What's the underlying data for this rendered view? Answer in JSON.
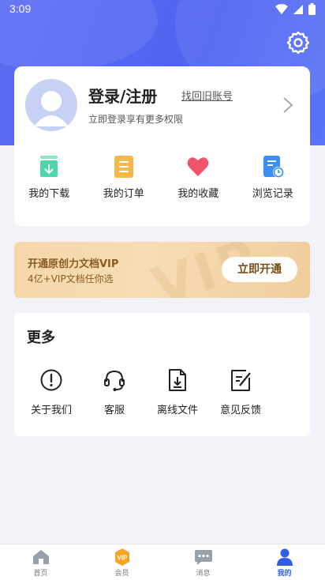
{
  "status_bar": {
    "time": "3:09"
  },
  "profile": {
    "login_title": "登录/注册",
    "recover_link": "找回旧账号",
    "login_sub": "立即登录享有更多权限"
  },
  "quick_actions": [
    {
      "label": "我的下载",
      "icon": "download-tray-icon",
      "color": "#4dd6a8"
    },
    {
      "label": "我的订单",
      "icon": "order-list-icon",
      "color": "#f7b84a"
    },
    {
      "label": "我的收藏",
      "icon": "heart-icon",
      "color": "#f0546a"
    },
    {
      "label": "浏览记录",
      "icon": "history-document-icon",
      "color": "#3a8ff5"
    }
  ],
  "vip": {
    "title": "开通原创力文档VIP",
    "subtitle": "4亿+VIP文档任你选",
    "button": "立即开通",
    "watermark": "VIP"
  },
  "more": {
    "title": "更多",
    "items": [
      {
        "label": "关于我们",
        "icon": "info-exclamation-icon"
      },
      {
        "label": "客服",
        "icon": "headset-icon"
      },
      {
        "label": "离线文件",
        "icon": "file-download-icon"
      },
      {
        "label": "意见反馈",
        "icon": "feedback-edit-icon"
      }
    ]
  },
  "tabs": [
    {
      "label": "首页",
      "icon": "home-icon"
    },
    {
      "label": "会员",
      "icon": "vip-badge-icon",
      "badge": "VIP"
    },
    {
      "label": "消息",
      "icon": "message-bubble-icon"
    },
    {
      "label": "我的",
      "icon": "person-icon",
      "active": true
    }
  ],
  "colors": {
    "accent": "#2f5fe8",
    "header": "#5468f2",
    "vip_text": "#8a5a22"
  }
}
